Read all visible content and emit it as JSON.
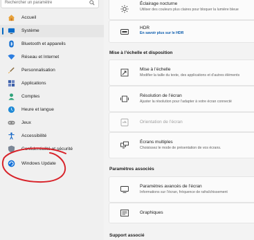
{
  "sidebar": {
    "search_placeholder": "Rechercher un paramètre",
    "items": [
      {
        "label": "Accueil",
        "icon": "home-icon"
      },
      {
        "label": "Système",
        "icon": "system-display-icon",
        "selected": true
      },
      {
        "label": "Bluetooth et appareils",
        "icon": "bluetooth-icon"
      },
      {
        "label": "Réseau et Internet",
        "icon": "wifi-icon"
      },
      {
        "label": "Personnalisation",
        "icon": "brush-icon"
      },
      {
        "label": "Applications",
        "icon": "apps-icon"
      },
      {
        "label": "Comptes",
        "icon": "account-icon"
      },
      {
        "label": "Heure et langue",
        "icon": "globe-clock-icon"
      },
      {
        "label": "Jeux",
        "icon": "gamepad-icon"
      },
      {
        "label": "Accessibilité",
        "icon": "accessibility-icon"
      },
      {
        "label": "Confidentialité et sécurité",
        "icon": "shield-icon"
      },
      {
        "label": "Windows Update",
        "icon": "windows-update-icon"
      }
    ]
  },
  "main": {
    "night_light": {
      "title": "Éclairage nocturne",
      "subtitle": "Utiliser des couleurs plus claires pour bloquer la lumière bleue"
    },
    "hdr": {
      "title": "HDR",
      "link": "En savoir plus sur le HDR"
    },
    "section_scale": "Mise à l’échelle et disposition",
    "scale": {
      "title": "Mise à l’échelle",
      "subtitle": "Modifier la taille du texte, des applications et d’autres éléments"
    },
    "resolution": {
      "title": "Résolution de l’écran",
      "subtitle": "Ajuster la résolution pour l’adapter à votre écran connecté"
    },
    "orientation": {
      "title": "Orientation de l’écran"
    },
    "multi": {
      "title": "Écrans multiples",
      "subtitle": "Choisissez le mode de présentation de vos écrans."
    },
    "section_related": "Paramètres associés",
    "advanced": {
      "title": "Paramètres avancés de l’écran",
      "subtitle": "Informations sur l’écran, fréquence de rafraîchissement"
    },
    "graphics": {
      "title": "Graphiques"
    },
    "section_support": "Support associé"
  },
  "colors": {
    "accent": "#0067c0",
    "annotation": "#d8232a"
  }
}
